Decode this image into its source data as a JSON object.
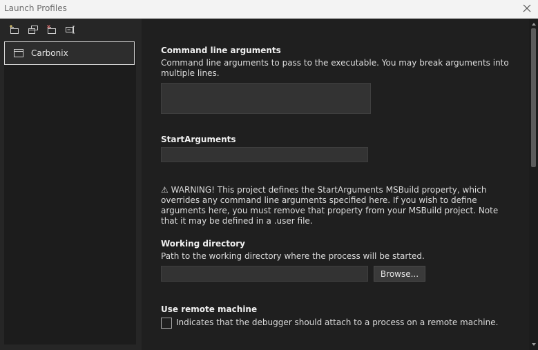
{
  "window": {
    "title": "Launch Profiles"
  },
  "toolbar": {
    "icons": [
      "new-profile-icon",
      "duplicate-profile-icon",
      "delete-profile-icon",
      "rename-profile-icon"
    ]
  },
  "profiles": [
    {
      "label": "Carbonix",
      "selected": true
    }
  ],
  "settings": {
    "command_line": {
      "title": "Command line arguments",
      "description": "Command line arguments to pass to the executable. You may break arguments into multiple lines.",
      "value": ""
    },
    "start_arguments": {
      "title": "StartArguments",
      "value": "",
      "warning_icon": "⚠",
      "warning": "WARNING! This project defines the StartArguments MSBuild property, which overrides any command line arguments specified here. If you wish to define arguments here, you must remove that property from your MSBuild project. Note that it may be defined in a .user file."
    },
    "working_directory": {
      "title": "Working directory",
      "description": "Path to the working directory where the process will be started.",
      "value": "",
      "browse_label": "Browse..."
    },
    "remote_machine": {
      "title": "Use remote machine",
      "checkbox_label": "Indicates that the debugger should attach to a process on a remote machine.",
      "checked": false
    }
  },
  "colors": {
    "background": "#1f1f1f",
    "sidebar": "#262626",
    "input": "#333333",
    "titlebar": "#f3f3f3",
    "selection_border": "#d8d8d8"
  }
}
